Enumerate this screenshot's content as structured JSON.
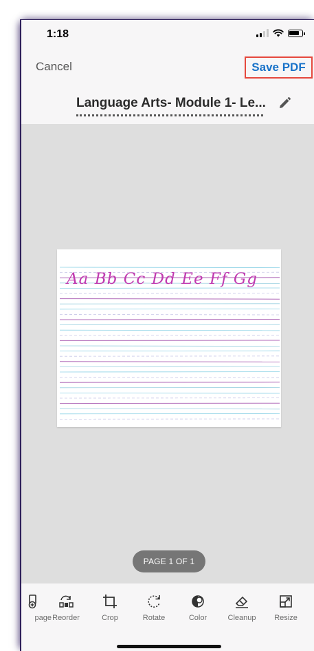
{
  "status": {
    "time": "1:18"
  },
  "nav": {
    "cancel_label": "Cancel",
    "save_label": "Save PDF"
  },
  "document": {
    "title": "Language Arts- Module 1- Le..."
  },
  "preview": {
    "handwriting": "Aa Bb Cc Dd Ee Ff Gg",
    "page_indicator": "PAGE 1 OF 1"
  },
  "toolbar": {
    "items": [
      {
        "label": "page",
        "icon": "add-page-icon"
      },
      {
        "label": "Reorder",
        "icon": "reorder-icon"
      },
      {
        "label": "Crop",
        "icon": "crop-icon"
      },
      {
        "label": "Rotate",
        "icon": "rotate-icon"
      },
      {
        "label": "Color",
        "icon": "color-icon"
      },
      {
        "label": "Cleanup",
        "icon": "eraser-icon"
      },
      {
        "label": "Resize",
        "icon": "resize-icon"
      }
    ]
  },
  "colors": {
    "accent": "#1a73c9",
    "highlight_border": "#e5483d",
    "ink": "#c03ab0"
  }
}
